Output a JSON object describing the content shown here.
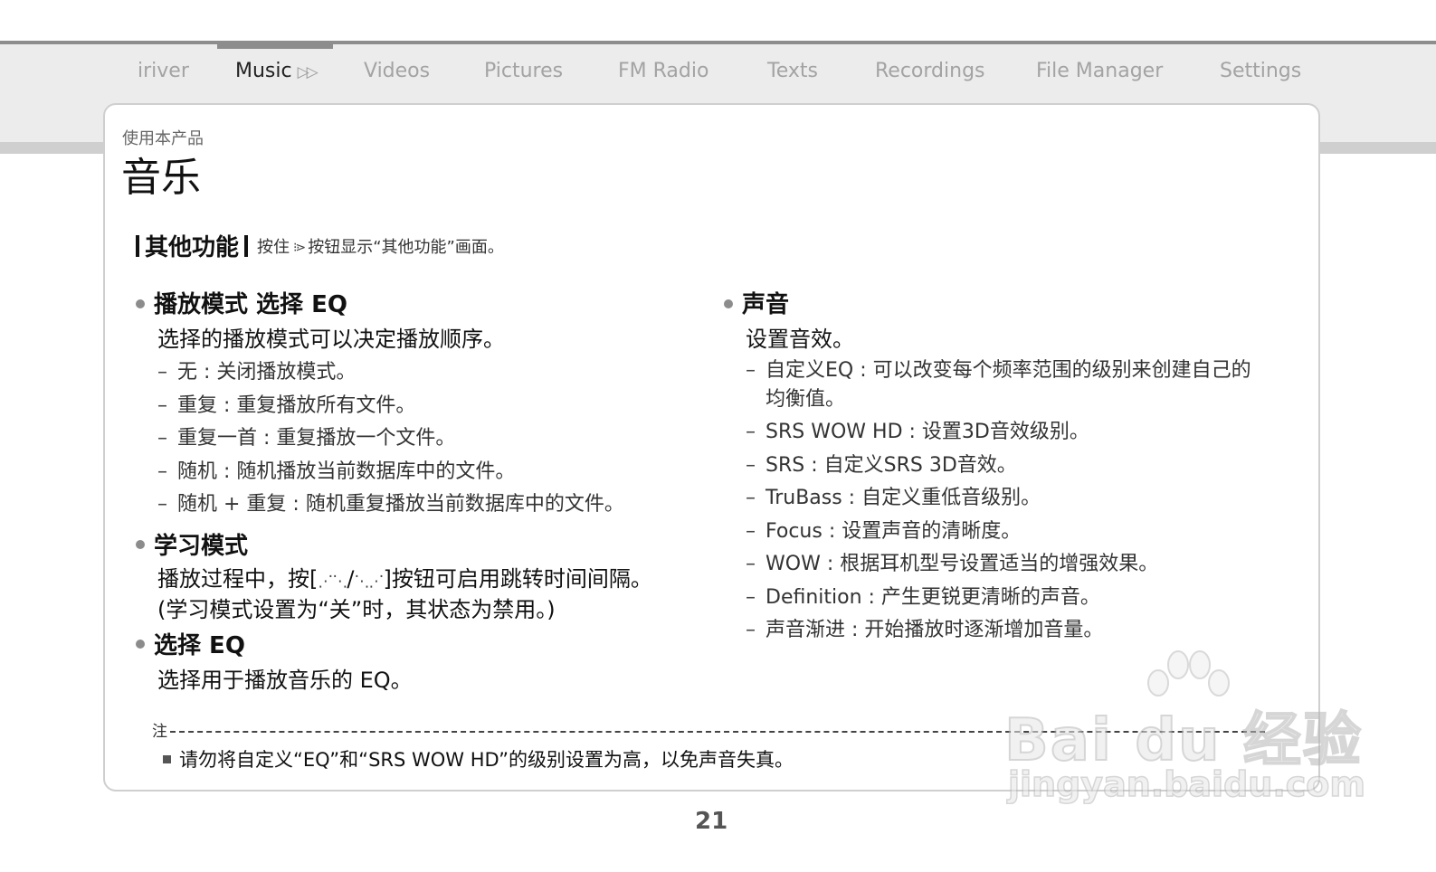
{
  "nav": {
    "tabs": [
      {
        "label": "iriver"
      },
      {
        "label": "Music"
      },
      {
        "label": "Videos"
      },
      {
        "label": "Pictures"
      },
      {
        "label": "FM Radio"
      },
      {
        "label": "Texts"
      },
      {
        "label": "Recordings"
      },
      {
        "label": "File Manager"
      },
      {
        "label": "Settings"
      }
    ],
    "active_play_glyph": "▷▷"
  },
  "header": {
    "kicker": "使用本产品",
    "title": "音乐"
  },
  "functions": {
    "title": "其他功能",
    "desc_prefix": "按住",
    "dots_glyph": "⁝⋗",
    "desc_suffix": "按钮显示“其他功能”画面。"
  },
  "left": {
    "play_mode": {
      "heading": "播放模式 选择 EQ",
      "desc": "选择的播放模式可以决定播放顺序。",
      "items": [
        "无 : 关闭播放模式。",
        "重复 : 重复播放所有文件。",
        "重复一首 : 重复播放一个文件。",
        "随机 : 随机播放当前数据库中的文件。",
        "随机 + 重复 : 随机重复播放当前数据库中的文件。"
      ]
    },
    "study_mode": {
      "heading": "学习模式",
      "line1_prefix": "播放过程中，按[",
      "line1_sym_a": "⋰⋱",
      "line1_sep": "/",
      "line1_sym_b": "⋱⋰",
      "line1_suffix": "]按钮可启用跳转时间间隔。",
      "line2": "(学习模式设置为“关”时，其状态为禁用。)"
    },
    "select_eq": {
      "heading": "选择 EQ",
      "desc": "选择用于播放音乐的 EQ。"
    }
  },
  "right": {
    "sound": {
      "heading": "声音",
      "desc": "设置音效。",
      "items": [
        "自定义EQ : 可以改变每个频率范围的级别来创建自己的均衡值。",
        "SRS WOW HD : 设置3D音效级别。",
        "SRS : 自定义SRS 3D音效。",
        "TruBass : 自定义重低音级别。",
        "Focus : 设置声音的清晰度。",
        "WOW : 根据耳机型号设置适当的增强效果。",
        "Definition : 产生更锐更清晰的声音。",
        "声音渐进 : 开始播放时逐渐增加音量。"
      ]
    }
  },
  "note": {
    "label": "注",
    "text": "请勿将自定义“EQ”和“SRS WOW HD”的级别设置为高，以免声音失真。"
  },
  "footer": {
    "page_number": "21"
  },
  "watermark": {
    "brand": "Bai du 经验",
    "url": "jingyan.baidu.com"
  },
  "dash_glyph": "–"
}
